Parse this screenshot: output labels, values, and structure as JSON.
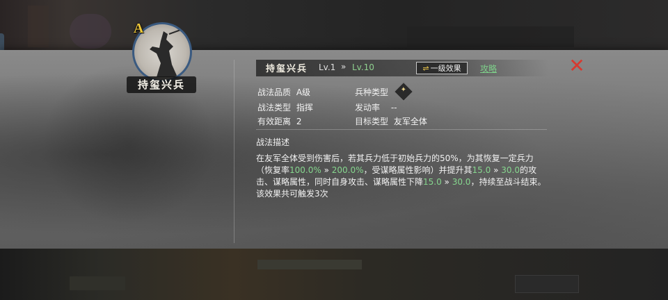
{
  "skill": {
    "name": "持玺兴兵",
    "grade": "A",
    "level": "Lv.1",
    "arrow": "»",
    "max_level": "Lv.10",
    "effect_button": "一级效果",
    "effect_icon": "⇌",
    "guide_link": "攻略",
    "close_icon": "✕"
  },
  "attributes": {
    "quality_label": "战法品质",
    "quality_value": "A级",
    "type_label": "战法类型",
    "type_value": "指挥",
    "range_label": "有效距离",
    "range_value": "2",
    "unit_label": "兵种类型",
    "rate_label": "发动率",
    "rate_value": "--",
    "target_label": "目标类型",
    "target_value": "友军全体"
  },
  "description": {
    "title": "战法描述",
    "part1": "在友军全体受到伤害后，若其兵力低于初始兵力的50%，为其恢复一定兵力（恢复率",
    "v1": "100.0%",
    "arrow1": " » ",
    "v2": "200.0%",
    "part2": "，受谋略属性影响）并提升其",
    "v3": "15.0",
    "arrow2": " » ",
    "v4": "30.0",
    "part3": "的攻击、谋略属性，同时自身攻击、谋略属性下降",
    "v5": "15.0",
    "arrow3": " » ",
    "v6": "30.0",
    "part4": "，持续至战斗结束。该效果共可触发3次"
  }
}
